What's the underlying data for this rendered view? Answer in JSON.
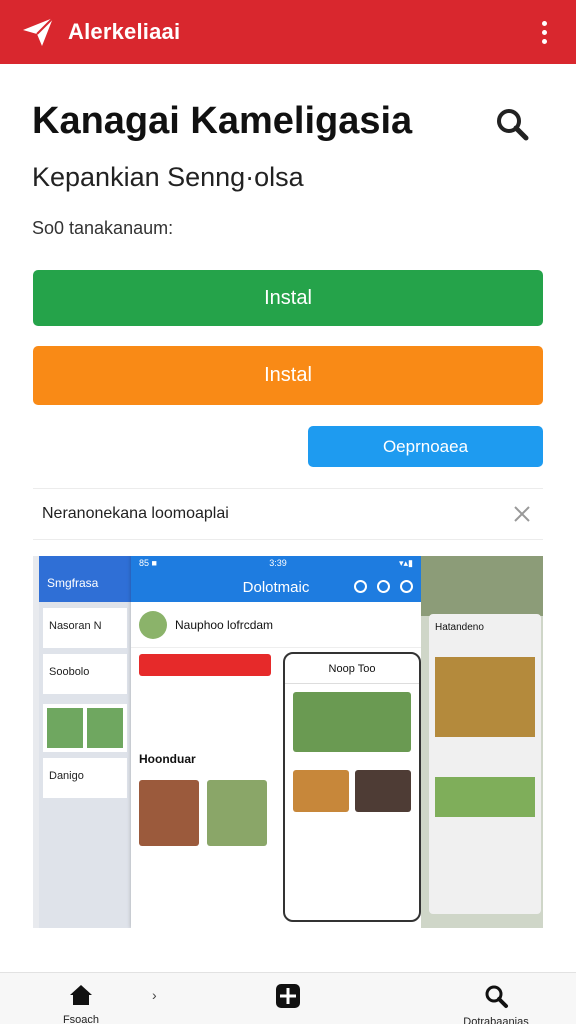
{
  "app_bar": {
    "title": "Alerkeliaai",
    "colors": {
      "background": "#d9272e"
    }
  },
  "header": {
    "title": "Kanagai Kameligasia",
    "subtitle": "Kepankian Senng·olsa",
    "meta": "So0 tanakanaum:"
  },
  "actions": {
    "install_primary": "Instal",
    "install_secondary": "Instal",
    "secondary_button": "Oeprnoaea",
    "colors": {
      "green": "#25a34a",
      "orange": "#f98a16",
      "blue": "#1e9bf0"
    }
  },
  "banner": {
    "text": "Neranonekana loomoaplai"
  },
  "gallery": {
    "left_screen": {
      "title": "Smgfrasa",
      "profile": "Nasoran N",
      "row1": "Soobolo",
      "row2": "Danigo"
    },
    "main_screen": {
      "status_left": "85 ■",
      "status_center": "3:39",
      "title": "Dolotmaic",
      "profile_name": "Nauphoo lofrcdam",
      "section_title": "Hoonduar"
    },
    "overlay_screen": {
      "title": "Noop Too"
    },
    "right_screen": {
      "title": "Hatandeno"
    }
  },
  "bottom_nav": {
    "home_label": "Fsoach",
    "add_label": "",
    "search_label": "Dotrabaanias"
  }
}
